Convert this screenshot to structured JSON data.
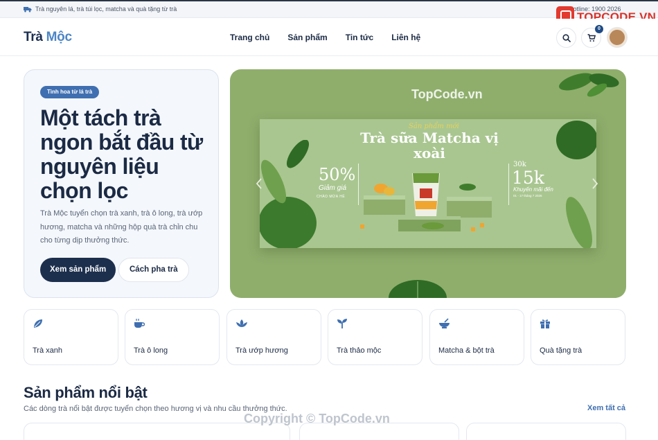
{
  "topbar": {
    "announcement": "Trà nguyên lá, trà túi lọc, matcha và quà tặng từ trà",
    "hotline": "Hotline: 1900 2026"
  },
  "watermark": {
    "logo_text": "TOPCODE.VN",
    "banner_text": "TopCode.vn",
    "bottom_text": "Copyright © TopCode.vn"
  },
  "header": {
    "brand_part1": "Trà",
    "brand_part2": "Mộc",
    "nav": [
      "Trang chủ",
      "Sản phẩm",
      "Tin tức",
      "Liên hệ"
    ],
    "cart_count": "0",
    "icons": [
      "search-icon",
      "cart-icon",
      "avatar"
    ]
  },
  "hero": {
    "tag": "Tinh hoa từ lá trà",
    "title": "Một tách trà ngon bắt đầu từ nguyên liệu chọn lọc",
    "description": "Trà Mộc tuyển chọn trà xanh, trà ô long, trà ướp hương, matcha và những hộp quà trà chỉn chu cho từng dịp thưởng thức.",
    "primary_button": "Xem sản phẩm",
    "secondary_button": "Cách pha trà"
  },
  "banner": {
    "subtitle": "Sản phẩm mới",
    "title": "Trà sữa Matcha vị xoài",
    "discount": "50%",
    "discount_label": "Giảm giá",
    "discount_sub": "CHÀO MỪA HÈ",
    "old_price": "30k",
    "new_price": "15k",
    "price_label": "Khuyến mãi đến",
    "date_text": "01 - 17 tháng 7 2026",
    "colors": {
      "background": "#8fae6c",
      "poster": "#a9c690"
    }
  },
  "categories": [
    {
      "label": "Trà xanh",
      "icon": "leaf-icon"
    },
    {
      "label": "Trà ô long",
      "icon": "teacup-icon"
    },
    {
      "label": "Trà ướp hương",
      "icon": "lotus-icon"
    },
    {
      "label": "Trà thảo mộc",
      "icon": "sprout-icon"
    },
    {
      "label": "Matcha & bột trà",
      "icon": "bowl-icon"
    },
    {
      "label": "Quà tặng trà",
      "icon": "gift-icon"
    }
  ],
  "featured": {
    "title": "Sản phẩm nổi bật",
    "subtitle": "Các dòng trà nổi bật được tuyển chọn theo hương vị và nhu cầu thưởng thức.",
    "see_all": "Xem tất cả"
  },
  "colors": {
    "primary": "#1c2f4d",
    "accent": "#3f6fb0",
    "hero_bg": "#f4f7fc"
  }
}
